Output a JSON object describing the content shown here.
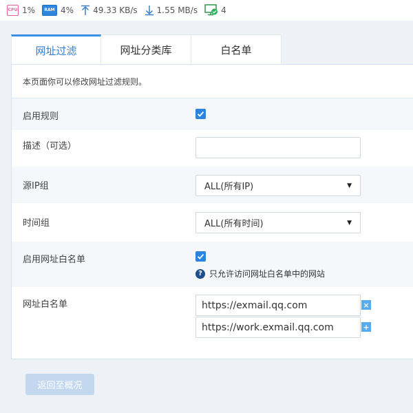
{
  "status": {
    "cpu_chip": "CPU",
    "cpu_value": "1%",
    "ram_chip": "RAM",
    "ram_value": "4%",
    "upload": "49.33 KB/s",
    "download": "1.55 MB/s",
    "connections": "4"
  },
  "tabs": [
    "网址过滤",
    "网址分类库",
    "白名单"
  ],
  "intro": "本页面你可以修改网址过滤规则。",
  "form": {
    "enable_rule_label": "启用规则",
    "enable_rule_checked": true,
    "description_label": "描述（可选）",
    "description_value": "",
    "source_ip_label": "源IP组",
    "source_ip_value": "ALL(所有IP)",
    "time_group_label": "时间组",
    "time_group_value": "ALL(所有时间)",
    "enable_whitelist_label": "启用网址白名单",
    "enable_whitelist_checked": true,
    "whitelist_hint": "只允许访问网址白名单中的网站",
    "whitelist_label": "网址白名单",
    "whitelist_urls": [
      "https://exmail.qq.com",
      "https://work.exmail.qq.com"
    ],
    "remove_symbol": "×",
    "add_symbol": "+"
  },
  "back_button": "返回至概况",
  "colors": {
    "accent": "#2c84df",
    "tab_active_border": "#3a8ee6",
    "back_button": "#c3d8ef",
    "hint_icon": "#1f4e8c"
  },
  "icons": [
    "cpu-icon",
    "ram-icon",
    "upload-arrow-icon",
    "download-arrow-icon",
    "connection-monitor-icon",
    "question-icon",
    "remove-icon",
    "add-icon",
    "checkmark-icon",
    "caret-down-icon"
  ]
}
